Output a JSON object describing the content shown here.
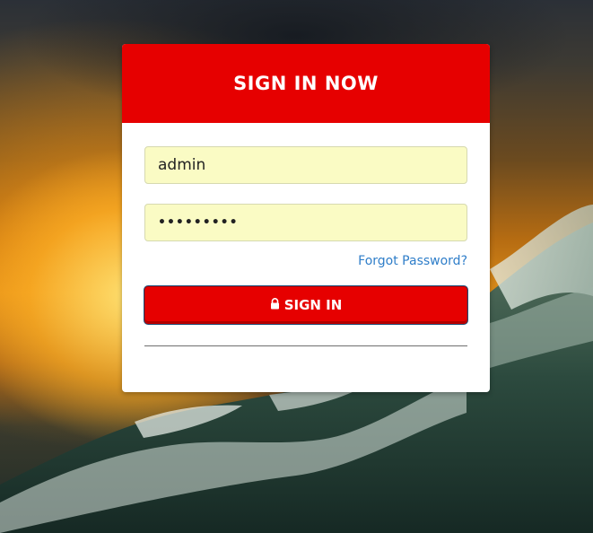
{
  "login": {
    "title": "SIGN IN NOW",
    "username_value": "admin",
    "password_value": "•••••••••",
    "forgot_label": "Forgot Password?",
    "signin_label": "SIGN IN"
  },
  "icons": {
    "signin": "lock-icon"
  },
  "colors": {
    "header": "#e60000",
    "button": "#e60000",
    "input_bg": "#fafbc4",
    "link": "#2f7ec9"
  }
}
